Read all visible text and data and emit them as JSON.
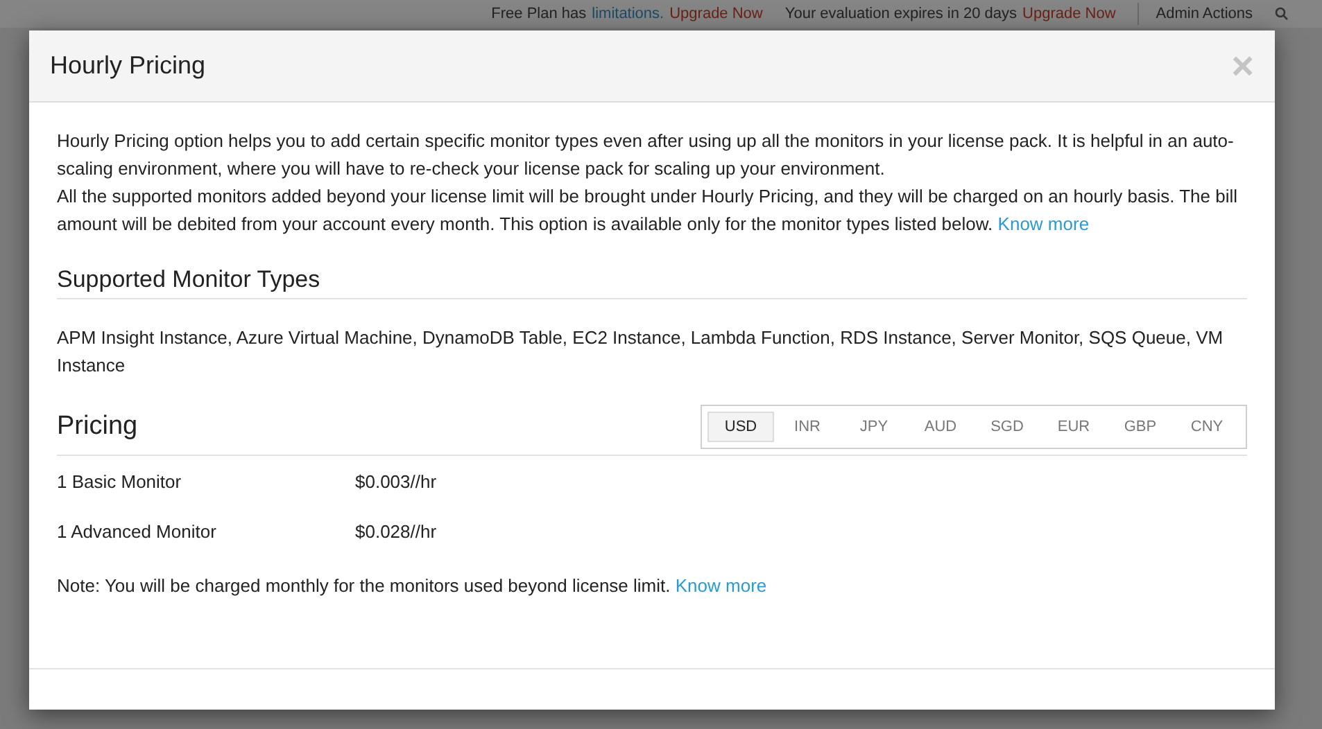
{
  "background_bar": {
    "plan_text": "Free Plan has",
    "plan_link": "limitations.",
    "plan_upgrade": "Upgrade Now",
    "evaluation_text": "Your evaluation expires in 20 days",
    "evaluation_upgrade": "Upgrade Now",
    "admin_actions": "Admin Actions"
  },
  "dialog": {
    "title": "Hourly Pricing",
    "close": "×",
    "intro": [
      "Hourly Pricing option helps you to add certain specific monitor types even after using up all the monitors in your license pack. It is helpful in an auto-scaling environment, where you will have to re-check your license pack for scaling up your environment.",
      "All the supported monitors added beyond your license limit will be brought under Hourly Pricing, and they will be charged on an hourly basis. The bill amount will be debited from your account every month. This option is available only for the monitor types listed below."
    ],
    "intro_link": "Know more",
    "supported_heading": "Supported Monitor Types",
    "supported_list": "APM Insight Instance, Azure Virtual Machine, DynamoDB Table, EC2 Instance, Lambda Function, RDS Instance, Server Monitor, SQS Queue, VM Instance",
    "pricing_heading": "Pricing",
    "currencies": [
      {
        "label": "USD",
        "selected": true
      },
      {
        "label": "INR",
        "selected": false
      },
      {
        "label": "JPY",
        "selected": false
      },
      {
        "label": "AUD",
        "selected": false
      },
      {
        "label": "SGD",
        "selected": false
      },
      {
        "label": "EUR",
        "selected": false
      },
      {
        "label": "GBP",
        "selected": false
      },
      {
        "label": "CNY",
        "selected": false
      }
    ],
    "prices": [
      {
        "name": "1 Basic Monitor",
        "price": "$0.003//hr"
      },
      {
        "name": "1 Advanced Monitor",
        "price": "$0.028//hr"
      }
    ],
    "note": "Note: You will be charged monthly for the monitors used beyond license limit.",
    "note_link": "Know more"
  }
}
